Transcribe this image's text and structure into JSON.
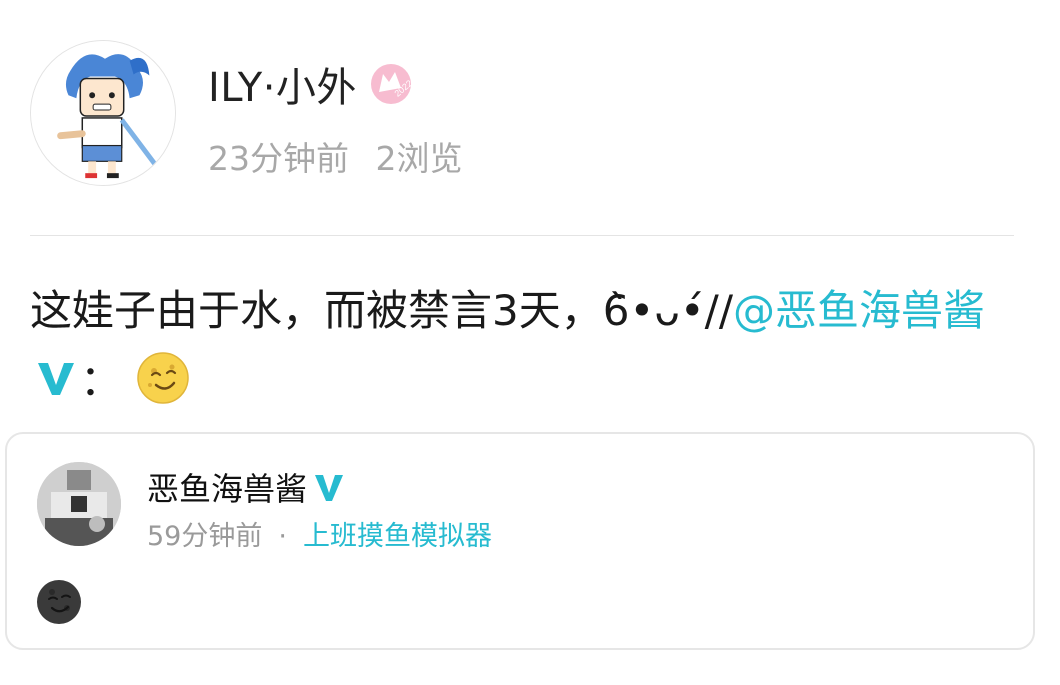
{
  "author": {
    "name": "ILY·小外",
    "time": "23分钟前",
    "views": "2浏览",
    "badge_icon": "anniversary-2022-badge-icon",
    "badge_text": "2022"
  },
  "post": {
    "text": "这娃子由于水，而被禁言3天，6̀•ᴗ•́//",
    "mention": "@恶鱼海兽酱",
    "colon": "：",
    "verified_icon": "verified-v-icon",
    "emoji": "sly-smile-emoji"
  },
  "quote": {
    "name": "恶鱼海兽酱",
    "time": "59分钟前",
    "dot": "·",
    "source": "上班摸鱼模拟器",
    "emoji": "dark-moon-face-emoji"
  },
  "colors": {
    "accent": "#27bbd0",
    "meta_gray": "#a8a8a8",
    "border": "#e6e6e6"
  }
}
